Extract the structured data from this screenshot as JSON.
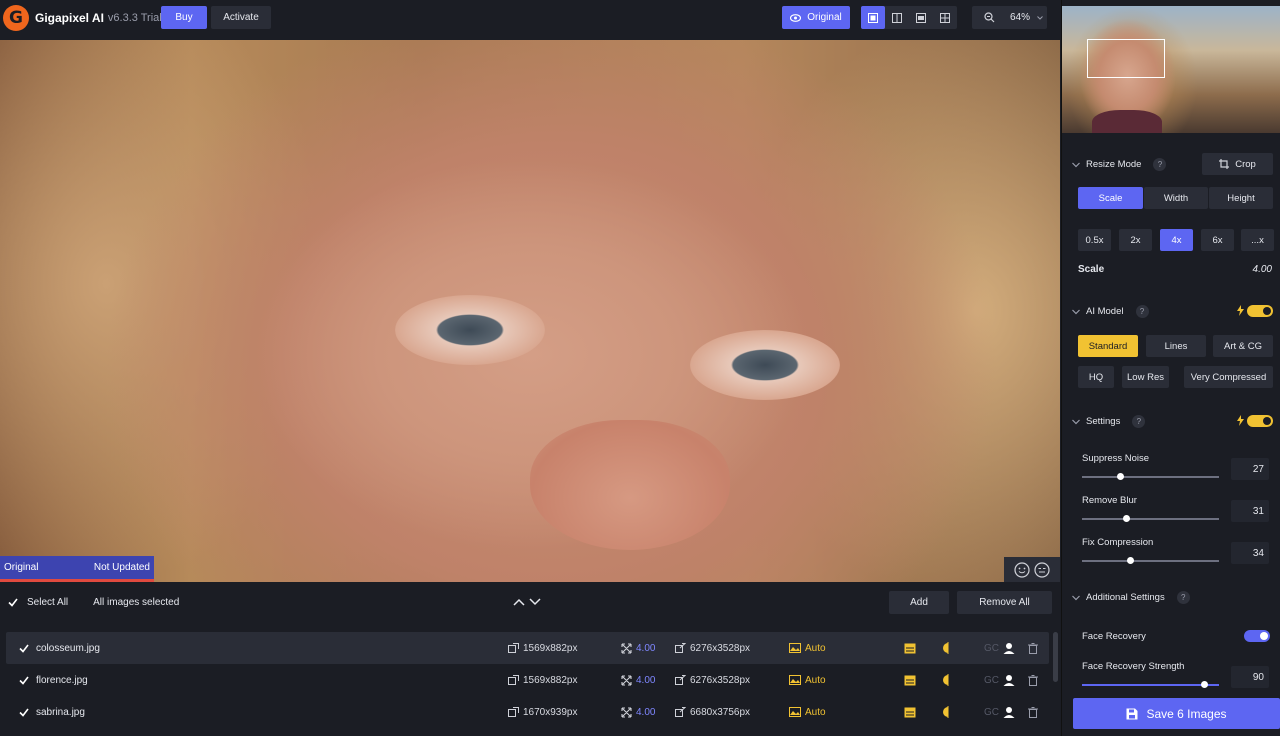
{
  "app": {
    "logo_letter": "G",
    "title": "Gigapixel AI",
    "version": "v6.3.3 Trial",
    "help": "?"
  },
  "topbar": {
    "buy_label": "Buy",
    "activate_label": "Activate",
    "original_label": "Original",
    "zoom_level": "64%"
  },
  "viewer": {
    "original_tag": "Original",
    "status_tag": "Not Updated"
  },
  "list_toolbar": {
    "select_all": "Select All",
    "selection_status": "All images selected",
    "add_label": "Add",
    "remove_all_label": "Remove All"
  },
  "images": [
    {
      "name": "colosseum.jpg",
      "source_size": "1569x882px",
      "scale": "4.00",
      "output_size": "6276x3528px",
      "mode": "Auto",
      "gc": "GC"
    },
    {
      "name": "florence.jpg",
      "source_size": "1569x882px",
      "scale": "4.00",
      "output_size": "6276x3528px",
      "mode": "Auto",
      "gc": "GC"
    },
    {
      "name": "sabrina.jpg",
      "source_size": "1670x939px",
      "scale": "4.00",
      "output_size": "6680x3756px",
      "mode": "Auto",
      "gc": "GC"
    }
  ],
  "panel": {
    "resize_mode": {
      "title": "Resize Mode",
      "crop_label": "Crop",
      "tabs": [
        "Scale",
        "Width",
        "Height"
      ],
      "presets": [
        "0.5x",
        "2x",
        "4x",
        "6x",
        "...x"
      ],
      "scale_label": "Scale",
      "scale_value": "4.00"
    },
    "ai_model": {
      "title": "AI Model",
      "models_row1": [
        "Standard",
        "Lines",
        "Art & CG"
      ],
      "models_row2": [
        "HQ",
        "Low Res",
        "Very Compressed"
      ]
    },
    "settings": {
      "title": "Settings",
      "suppress_noise_label": "Suppress Noise",
      "suppress_noise_value": "27",
      "remove_blur_label": "Remove Blur",
      "remove_blur_value": "31",
      "fix_compression_label": "Fix Compression",
      "fix_compression_value": "34"
    },
    "additional": {
      "title": "Additional Settings",
      "face_recovery_label": "Face Recovery",
      "face_recovery_strength_label": "Face Recovery Strength",
      "face_recovery_strength_value": "90"
    },
    "save_label": "Save 6 Images"
  },
  "colors": {
    "accent_blue": "#5d66f2",
    "accent_yellow": "#f1c232",
    "background": "#1b1d24"
  }
}
